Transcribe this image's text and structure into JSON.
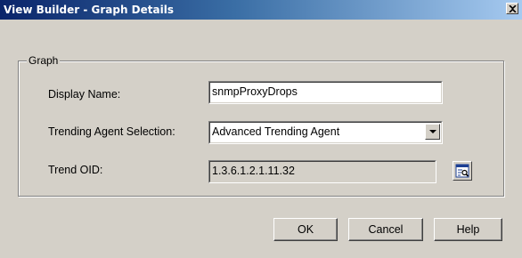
{
  "window": {
    "title": "View Builder - Graph Details",
    "close_symbol": "×"
  },
  "group": {
    "legend": "Graph"
  },
  "form": {
    "display_name_label": "Display Name:",
    "display_name_value": "snmpProxyDrops",
    "trending_agent_label": "Trending Agent Selection:",
    "trending_agent_value": "Advanced Trending Agent",
    "trend_oid_label": "Trend OID:",
    "trend_oid_value": "1.3.6.1.2.1.11.32"
  },
  "buttons": {
    "ok": "OK",
    "cancel": "Cancel",
    "help": "Help"
  },
  "icons": {
    "close": "close-icon",
    "dropdown": "chevron-down-icon",
    "browse": "mib-browse-icon"
  },
  "colors": {
    "titlebar_start": "#0a246a",
    "titlebar_end": "#a6caf0",
    "dialog_bg": "#d4d0c8",
    "readonly_field_bg": "#d4d0c8",
    "field_bg": "#ffffff"
  }
}
